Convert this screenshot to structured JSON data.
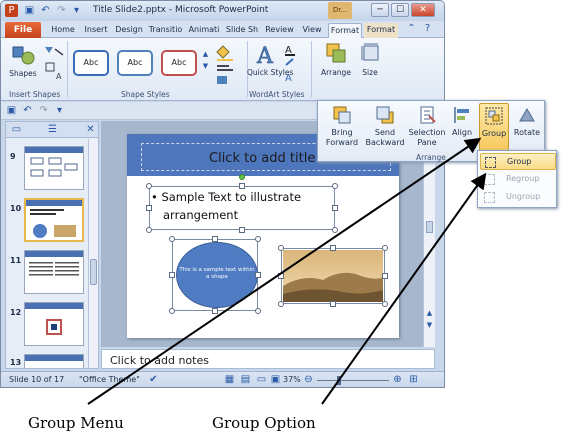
{
  "window": {
    "title": "Title Slide2.pptx - Microsoft PowerPoint",
    "user_badge": "Dr...",
    "minimize": "─",
    "maximize": "☐",
    "close": "✕"
  },
  "tabs": {
    "file": "File",
    "items": [
      "Home",
      "Insert",
      "Design",
      "Transitio",
      "Animati",
      "Slide Sh",
      "Review",
      "View",
      "Format",
      "Format"
    ]
  },
  "ribbon": {
    "insert_shapes_label": "Insert Shapes",
    "shapes_label": "Shapes",
    "shape_styles_label": "Shape Styles",
    "abc": [
      "Abc",
      "Abc",
      "Abc"
    ],
    "abc_colors": [
      "#3b6cb8",
      "#4f81bd",
      "#c0504d"
    ],
    "quick_styles_label": "Quick Styles",
    "wordart_label": "WordArt Styles",
    "arrange_label": "Arrange",
    "size_label": "Size"
  },
  "slides": [
    {
      "num": "9"
    },
    {
      "num": "10"
    },
    {
      "num": "11"
    },
    {
      "num": "12"
    },
    {
      "num": "13"
    }
  ],
  "slide": {
    "title_placeholder": "Click to add title",
    "body_line1": "• Sample Text to illustrate",
    "body_line2": "arrangement",
    "circle_text": "This is a sample text within a shape"
  },
  "notes": "Click to add notes",
  "status": {
    "slide_count": "Slide 10 of 17",
    "theme": "\"Office Theme\"",
    "zoom": "37%"
  },
  "arrange_panel": {
    "bring_forward": "Bring Forward",
    "send_backward": "Send Backward",
    "selection_pane": "Selection Pane",
    "align": "Align",
    "group": "Group",
    "rotate": "Rotate",
    "section_label": "Arrange"
  },
  "group_menu": {
    "group": "Group",
    "regroup": "Regroup",
    "ungroup": "Ungroup"
  },
  "callouts": {
    "group_menu": "Group Menu",
    "group_option": "Group Option"
  }
}
